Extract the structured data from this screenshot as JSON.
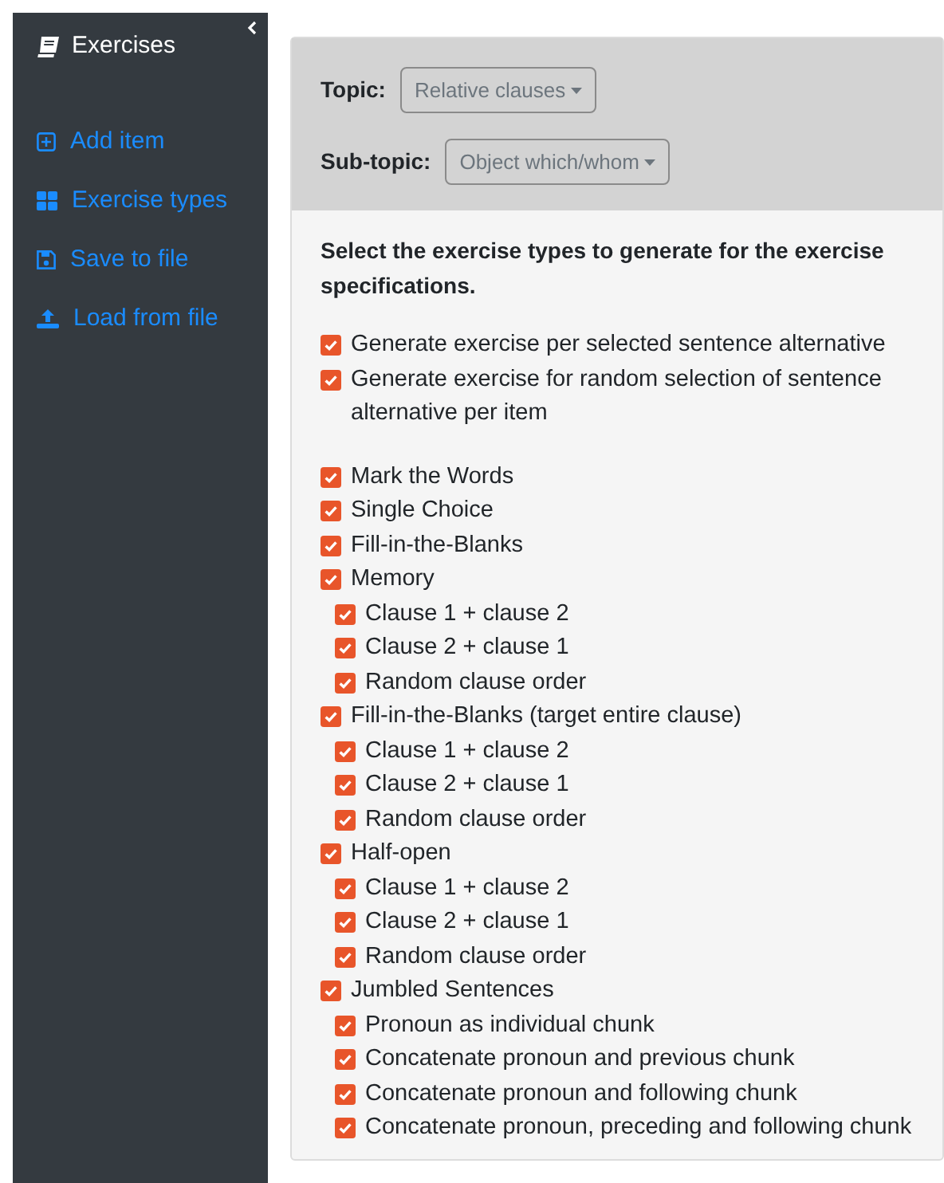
{
  "sidebar": {
    "title": "Exercises",
    "items": [
      {
        "label": "Add item",
        "kind": "add"
      },
      {
        "label": "Exercise types",
        "kind": "types"
      },
      {
        "label": "Save to file",
        "kind": "save"
      },
      {
        "label": "Load from file",
        "kind": "load"
      }
    ]
  },
  "filters": [
    {
      "label": "Topic:",
      "value": "Relative clauses"
    },
    {
      "label": "Sub-topic:",
      "value": "Object which/whom"
    }
  ],
  "instructions": "Select the exercise types to generate for the exercise specifications.",
  "generation_options": [
    {
      "label": "Generate exercise per selected sentence alternative",
      "checked": true
    },
    {
      "label": "Generate exercise for random selection of sentence alternative per item",
      "checked": true
    }
  ],
  "exercise_types": [
    {
      "label": "Mark the Words",
      "checked": true
    },
    {
      "label": "Single Choice",
      "checked": true
    },
    {
      "label": "Fill-in-the-Blanks",
      "checked": true
    },
    {
      "label": "Memory",
      "checked": true,
      "children": [
        {
          "label": "Clause 1 + clause 2",
          "checked": true
        },
        {
          "label": "Clause 2 + clause 1",
          "checked": true
        },
        {
          "label": "Random clause order",
          "checked": true
        }
      ]
    },
    {
      "label": "Fill-in-the-Blanks (target entire clause)",
      "checked": true,
      "children": [
        {
          "label": "Clause 1 + clause 2",
          "checked": true
        },
        {
          "label": "Clause 2 + clause 1",
          "checked": true
        },
        {
          "label": "Random clause order",
          "checked": true
        }
      ]
    },
    {
      "label": "Half-open",
      "checked": true,
      "children": [
        {
          "label": "Clause 1 + clause 2",
          "checked": true
        },
        {
          "label": "Clause 2 + clause 1",
          "checked": true
        },
        {
          "label": "Random clause order",
          "checked": true
        }
      ]
    },
    {
      "label": "Jumbled Sentences",
      "checked": true,
      "children": [
        {
          "label": "Pronoun as individual chunk",
          "checked": true
        },
        {
          "label": "Concatenate pronoun and previous chunk",
          "checked": true
        },
        {
          "label": "Concatenate pronoun and following chunk",
          "checked": true
        },
        {
          "label": "Concatenate pronoun, preceding and following chunk",
          "checked": true
        }
      ]
    }
  ]
}
